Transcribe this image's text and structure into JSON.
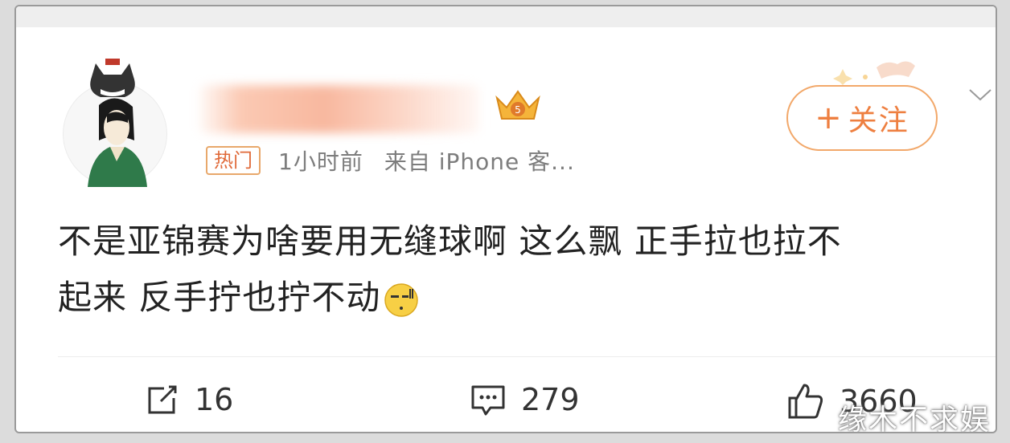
{
  "post": {
    "hot_badge": "热门",
    "time": "1小时前",
    "source": "来自 iPhone 客...",
    "follow_label": "关注",
    "follow_plus": "+",
    "content": "不是亚锦赛为啥要用无缝球啊 这么飘 正手拉也拉不起来 反手拧也拧不动",
    "content_line1": "不是亚锦赛为啥要用无缝球啊 这么飘 正手拉也拉不",
    "content_line2": "起来 反手拧也拧不动"
  },
  "actions": {
    "repost_count": "16",
    "comment_count": "279",
    "like_count": "3660"
  },
  "watermark": "缘木不求娱",
  "icons": [
    "avatar-image",
    "vip-crown-icon",
    "chevron-down-icon",
    "sweat-emoji-icon",
    "share-icon",
    "comment-icon",
    "like-icon"
  ],
  "colors": {
    "accent": "#ee7f40",
    "badge_border": "#e8a86b",
    "meta": "#7d7d7d"
  }
}
